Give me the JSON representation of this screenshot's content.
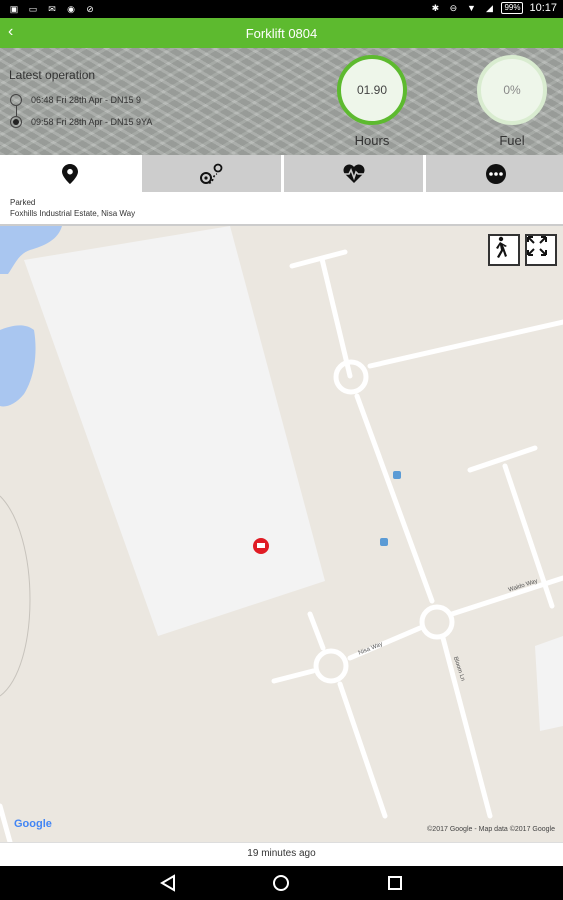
{
  "status_bar": {
    "left_icons": [
      "image-icon",
      "cast-icon",
      "mail-icon",
      "chrome-icon",
      "blocked-icon"
    ],
    "right_icons": [
      "bluetooth-icon",
      "minus-circle-icon",
      "wifi-icon",
      "signal-icon"
    ],
    "battery": "99%",
    "time": "10:17"
  },
  "app_bar": {
    "title": "Forklift 0804",
    "back_icon": "chevron-left-icon",
    "color": "#5dba2f"
  },
  "latest_operation": {
    "title": "Latest operation",
    "entries": [
      {
        "text": "06:48 Fri 28th Apr - DN15 9",
        "selected": false
      },
      {
        "text": "09:58 Fri 28th Apr - DN15 9YA",
        "selected": true
      }
    ]
  },
  "gauges": {
    "hours": {
      "value": "01.90",
      "label": "Hours"
    },
    "fuel": {
      "value": "0%",
      "label": "Fuel",
      "level": 0
    }
  },
  "tabs": [
    {
      "icon": "location-pin-icon",
      "active": true
    },
    {
      "icon": "route-icon",
      "active": false
    },
    {
      "icon": "heart-pulse-icon",
      "active": false
    },
    {
      "icon": "more-icon",
      "active": false
    }
  ],
  "info": {
    "state": "Parked",
    "location": "Foxhills Industrial Estate, Nisa Way"
  },
  "map": {
    "controls": [
      "walk-icon",
      "fullscreen-icon"
    ],
    "google_logo": "Google",
    "attribution": "©2017 Google - Map data ©2017 Google",
    "road_labels": [
      "Nisa Way",
      "Bloom Ln",
      "Waldo Way"
    ],
    "marker_icon": "forklift-marker-icon"
  },
  "footer": {
    "updated": "19 minutes ago"
  },
  "nav": [
    "back-icon",
    "home-icon",
    "recents-icon"
  ]
}
